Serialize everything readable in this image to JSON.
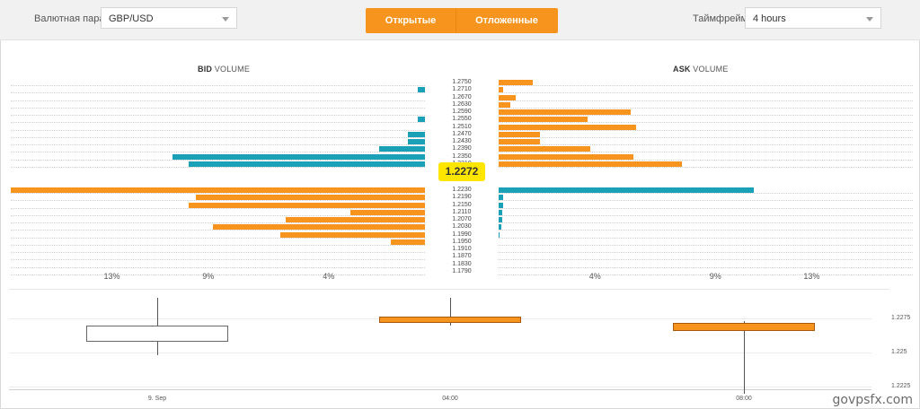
{
  "controls": {
    "pair_label": "Валютная пара",
    "pair_value": "GBP/USD",
    "tab_open": "Открытые",
    "tab_pending": "Отложенные",
    "timeframe_label": "Таймфрейм",
    "timeframe_value": "4 hours"
  },
  "watermark": "govpsfx.com",
  "chart_data": [
    {
      "type": "bar",
      "title_bid_bold": "BID",
      "title_bid_rest": " VOLUME",
      "title_ask_bold": "ASK",
      "title_ask_rest": " VOLUME",
      "current_price": "1.2272",
      "price_levels": [
        "1.2750",
        "1.2710",
        "1.2670",
        "1.2630",
        "1.2590",
        "1.2550",
        "1.2510",
        "1.2470",
        "1.2430",
        "1.2390",
        "1.2350",
        "1.2310",
        "1.2230",
        "1.2190",
        "1.2150",
        "1.2110",
        "1.2070",
        "1.2030",
        "1.1990",
        "1.1950",
        "1.1910",
        "1.1870",
        "1.1830",
        "1.1790"
      ],
      "bid_volume_pct": [
        0,
        0.3,
        0,
        0,
        0,
        0.3,
        0,
        0.7,
        0.7,
        1.9,
        10.5,
        9.8,
        17.2,
        9.5,
        9.8,
        3.1,
        5.8,
        8.8,
        6.0,
        1.4,
        0,
        0,
        0,
        0
      ],
      "bid_color": [
        "",
        "teal",
        "",
        "",
        "",
        "teal",
        "",
        "teal",
        "teal",
        "teal",
        "teal",
        "teal",
        "orange",
        "orange",
        "orange",
        "orange",
        "orange",
        "orange",
        "orange",
        "orange",
        "",
        "",
        "",
        ""
      ],
      "ask_volume_pct": [
        1.4,
        0.2,
        0.7,
        0.5,
        5.5,
        3.7,
        5.7,
        1.7,
        1.7,
        3.8,
        5.6,
        7.6,
        10.6,
        0.2,
        0.2,
        0.15,
        0.15,
        0.1,
        0.05,
        0,
        0,
        0,
        0,
        0
      ],
      "ask_color": [
        "orange",
        "orange",
        "orange",
        "orange",
        "orange",
        "orange",
        "orange",
        "orange",
        "orange",
        "orange",
        "orange",
        "orange",
        "teal",
        "teal",
        "teal",
        "teal",
        "teal",
        "teal",
        "teal",
        "",
        "",
        "",
        "",
        ""
      ],
      "pct_ticks": [
        "13%",
        "9%",
        "4%"
      ],
      "pct_tick_values": [
        13,
        9,
        4
      ],
      "xlim_pct": [
        0,
        17.2
      ]
    },
    {
      "type": "candlestick",
      "x": [
        "9. Sep",
        "04:00",
        "08:00"
      ],
      "candles": [
        {
          "open": 1.2258,
          "close": 1.227,
          "high": 1.229,
          "low": 1.2248,
          "style": "hollow"
        },
        {
          "open": 1.2276,
          "close": 1.2272,
          "high": 1.229,
          "low": 1.227,
          "style": "filled"
        },
        {
          "open": 1.2272,
          "close": 1.2266,
          "high": 1.2273,
          "low": 1.222,
          "style": "filled"
        }
      ],
      "y_ticks": [
        "1.2275",
        "1.225",
        "1.2225"
      ],
      "y_tick_values": [
        1.2275,
        1.225,
        1.2225
      ]
    }
  ]
}
